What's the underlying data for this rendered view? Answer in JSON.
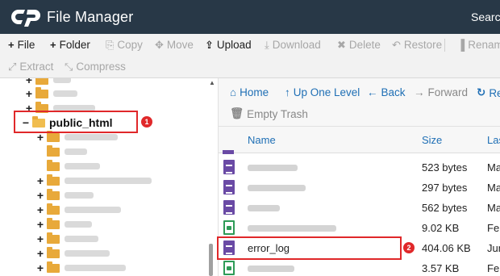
{
  "header": {
    "app_title": "File Manager",
    "search_label": "Search",
    "logo": "cpanel-logo"
  },
  "toolbar": {
    "row1": [
      {
        "icon": "+",
        "label": "File",
        "enabled": true
      },
      {
        "icon": "+",
        "label": "Folder",
        "enabled": true
      },
      {
        "icon": "⎘",
        "label": "Copy",
        "enabled": false
      },
      {
        "icon": "✥",
        "label": "Move",
        "enabled": false
      },
      {
        "icon": "⇪",
        "label": "Upload",
        "enabled": true
      },
      {
        "icon": "⤓",
        "label": "Download",
        "enabled": false
      },
      {
        "icon": "✖",
        "label": "Delete",
        "enabled": false
      },
      {
        "icon": "↶",
        "label": "Restore",
        "enabled": false
      },
      {
        "icon": "▐",
        "label": "Rename",
        "enabled": false
      }
    ],
    "row2": [
      {
        "icon": "⤢",
        "label": "Extract",
        "enabled": false
      },
      {
        "icon": "⤡",
        "label": "Compress",
        "enabled": false
      }
    ]
  },
  "tree": {
    "selected_label": "public_html",
    "selected_expander": "−"
  },
  "nav": {
    "home": "Home",
    "up": "Up One Level",
    "back": "Back",
    "forward": "Forward",
    "reload": "Rel",
    "empty_trash": "Empty Trash"
  },
  "table": {
    "headers": {
      "name": "Name",
      "size": "Size",
      "last": "Las"
    },
    "rows": [
      {
        "type": "text",
        "name": "",
        "size": "523 bytes",
        "date": "Ma"
      },
      {
        "type": "text",
        "name": "",
        "size": "297 bytes",
        "date": "Ma"
      },
      {
        "type": "text",
        "name": "",
        "size": "562 bytes",
        "date": "Ma"
      },
      {
        "type": "img",
        "name": "",
        "size": "9.02 KB",
        "date": "Feb"
      },
      {
        "type": "text",
        "name": "error_log",
        "size": "404.06 KB",
        "date": "Jun"
      },
      {
        "type": "img",
        "name": "",
        "size": "3.57 KB",
        "date": "Feb"
      }
    ]
  },
  "callouts": {
    "first": "1",
    "second": "2"
  },
  "colors": {
    "header_bg": "#283847",
    "toolbar_bg": "#f2f2f2",
    "link_blue": "#1f6fb5",
    "highlight_red": "#e0282a",
    "folder_yellow": "#e8a93a",
    "text_file_purple": "#6a4aa5",
    "image_file_green": "#2e9b57"
  }
}
